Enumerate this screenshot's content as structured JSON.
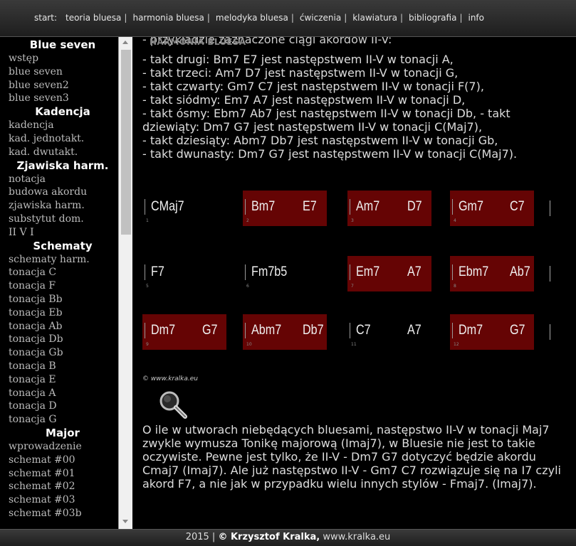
{
  "nav": {
    "items": [
      {
        "label": "start:",
        "sep": ""
      },
      {
        "label": "teoria bluesa",
        "sep": "|"
      },
      {
        "label": "harmonia bluesa",
        "sep": "|"
      },
      {
        "label": "melodyka bluesa",
        "sep": "|"
      },
      {
        "label": "ćwiczenia",
        "sep": "|"
      },
      {
        "label": "klawiatura",
        "sep": "|"
      },
      {
        "label": "bibliografia",
        "sep": "|"
      },
      {
        "label": "info",
        "sep": ""
      }
    ]
  },
  "sidebar": {
    "sections": [
      {
        "title": "Blue seven",
        "links": [
          "wstęp",
          "blue seven",
          "blue seven2",
          "blue seven3"
        ]
      },
      {
        "title": "Kadencja",
        "links": [
          "kadencja",
          "kad. jednotakt.",
          "kad. dwutakt."
        ]
      },
      {
        "title": "Zjawiska harm.",
        "links": [
          "notacja",
          "budowa akordu",
          "zjawiska harm.",
          "substytut dom.",
          "II V I"
        ]
      },
      {
        "title": "Schematy",
        "links": [
          "schematy harm.",
          "tonacja C",
          "tonacja F",
          "tonacja Bb",
          "tonacja Eb",
          "tonacja Ab",
          "tonacja Db",
          "tonacja Gb",
          "tonacja B",
          "tonacja E",
          "tonacja A",
          "tonacja D",
          "tonacja G"
        ]
      },
      {
        "title": "Major",
        "links": [
          "wprowadzenie",
          "schemat #00",
          "schemat #01",
          "schemat #02",
          "schemat #03",
          "schemat #03b"
        ]
      }
    ]
  },
  "main": {
    "heading": "HARMONIA BLUESA",
    "clipped_top": "- przykładzie zaznaczone ciągi akordów II-V:",
    "lines": [
      "- takt drugi: Bm7 E7 jest następstwem II-V w tonacji A,",
      "- takt trzeci: Am7 D7 jest następstwem II-V w tonacji G,",
      "- takt czwarty: Gm7 C7 jest następstwem II-V w tonacji F(7),",
      "- takt siódmy: Em7 A7 jest następstwem II-V w tonacji D,",
      "- takt ósmy: Ebm7 Ab7 jest następstwem II-V w tonacji Db, - takt dziewiąty: Dm7 G7 jest następstwem II-V w tonacji C(Maj7),",
      "- takt dziesiąty: Abm7 Db7 jest następstwem II-V w tonacji Gb,",
      "- takt dwunasty: Dm7 G7 jest następstwem II-V w tonacji C(Maj7)."
    ],
    "chart": {
      "rows": [
        [
          {
            "c1": "CMaj7",
            "c2": "",
            "hl": false,
            "num": "1"
          },
          {
            "c1": "Bm7",
            "c2": "E7",
            "hl": true,
            "num": "2"
          },
          {
            "c1": "Am7",
            "c2": "D7",
            "hl": true,
            "num": "3"
          },
          {
            "c1": "Gm7",
            "c2": "C7",
            "hl": true,
            "num": "4"
          }
        ],
        [
          {
            "c1": "F7",
            "c2": "",
            "hl": false,
            "num": "5"
          },
          {
            "c1": "Fm7b5",
            "c2": "",
            "hl": false,
            "num": "6"
          },
          {
            "c1": "Em7",
            "c2": "A7",
            "hl": true,
            "num": "7"
          },
          {
            "c1": "Ebm7",
            "c2": "Ab7",
            "hl": true,
            "num": "8"
          }
        ],
        [
          {
            "c1": "Dm7",
            "c2": "G7",
            "hl": true,
            "num": "9"
          },
          {
            "c1": "Abm7",
            "c2": "Db7",
            "hl": true,
            "num": "10"
          },
          {
            "c1": "C7",
            "c2": "A7",
            "hl": false,
            "num": "11"
          },
          {
            "c1": "Dm7",
            "c2": "G7",
            "hl": true,
            "num": "12"
          }
        ]
      ]
    },
    "watermark": "© www.kralka.eu",
    "paragraph": "O ile w utworach niebędących bluesami, następstwo II-V w tonacji Maj7 zwykle wymusza Tonikę majorową (Imaj7), w Bluesie nie jest to takie oczywiste. Pewne jest tylko, że II-V - Dm7 G7 dotyczyć będzie akordu Cmaj7 (Imaj7). Ale już następstwo II-V - Gm7 C7 rozwiązuje się na I7 czyli akord F7, a nie jak w przypadku wielu innych stylów - Fmaj7. (Imaj7)."
  },
  "footer": {
    "year": "2015",
    "sep": "|",
    "author": "© Krzysztof Kralka,",
    "site": "www.kralka.eu"
  },
  "colors": {
    "highlight": "#650404",
    "background": "#000000"
  }
}
